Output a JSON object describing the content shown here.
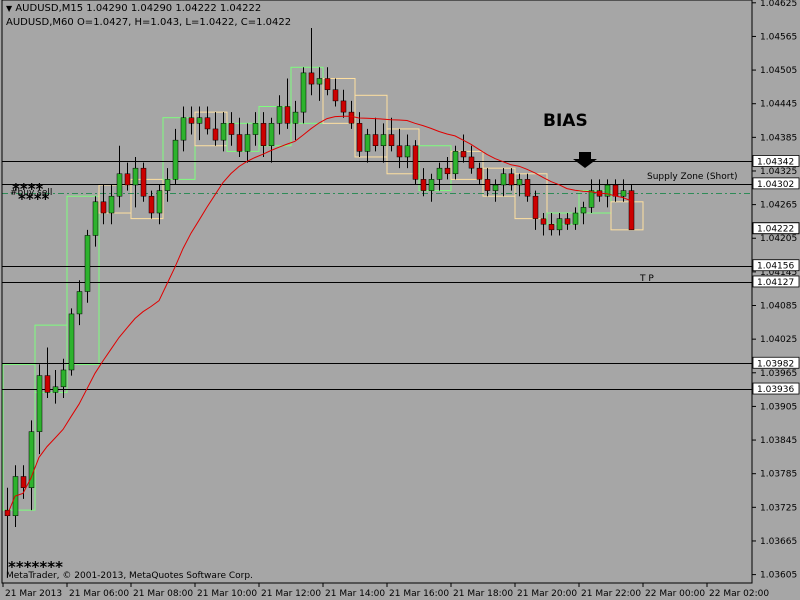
{
  "header": {
    "line1": "AUDUSD,M15  1.04290 1.04290 1.04222 1.04222",
    "line2": "AUDUSD,M60   O=1.0427,   H=1.043,   L=1.0422,   C=1.0422"
  },
  "colors": {
    "background": "#a6a6a6",
    "bull": "#2db32d",
    "bear": "#cc0000",
    "ma": "#e00000",
    "h1_bull_box": "#7dff7d",
    "h1_bear_box": "#ffe0a0",
    "hline": "#000000",
    "dashline": "#2e8b57"
  },
  "annotations": {
    "bias": "BIAS",
    "supply_zone": "Supply Zone (Short)",
    "tp": "T  P",
    "stars_top": "****",
    "stars_bottom": "*******",
    "label_buy_sell": "#buy sell",
    "copyright": "MetaTrader, © 2001-2013, MetaQuotes Software Corp."
  },
  "chart_data": {
    "type": "candlestick",
    "symbol": "AUDUSD",
    "timeframe": "M15",
    "ylim": [
      1.0359,
      1.0463
    ],
    "price_ticks": [
      "1.04625",
      "1.04565",
      "1.04505",
      "1.04445",
      "1.04385",
      "1.04325",
      "1.04265",
      "1.04205",
      "1.04145",
      "1.04085",
      "1.04025",
      "1.03965",
      "1.03905",
      "1.03845",
      "1.03785",
      "1.03725",
      "1.03665",
      "1.03605"
    ],
    "time_ticks": [
      {
        "label": "21 Mar 2013",
        "bar": 0
      },
      {
        "label": "21 Mar 06:00",
        "bar": 8
      },
      {
        "label": "21 Mar 08:00",
        "bar": 16
      },
      {
        "label": "21 Mar 10:00",
        "bar": 24
      },
      {
        "label": "21 Mar 12:00",
        "bar": 32
      },
      {
        "label": "21 Mar 14:00",
        "bar": 40
      },
      {
        "label": "21 Mar 16:00",
        "bar": 48
      },
      {
        "label": "21 Mar 18:00",
        "bar": 56
      },
      {
        "label": "21 Mar 20:00",
        "bar": 64
      },
      {
        "label": "21 Mar 22:00",
        "bar": 72
      },
      {
        "label": "22 Mar 00:00",
        "bar": 80
      },
      {
        "label": "22 Mar 02:00",
        "bar": 88
      }
    ],
    "levels": [
      {
        "price": 1.04342,
        "label": "1.04342",
        "style": "solid"
      },
      {
        "price": 1.04302,
        "label": "1.04302",
        "style": "solid"
      },
      {
        "price": 1.04285,
        "label": "",
        "style": "dash"
      },
      {
        "price": 1.04222,
        "label": "1.04222",
        "style": "current"
      },
      {
        "price": 1.04156,
        "label": "1.04156",
        "style": "solid"
      },
      {
        "price": 1.04127,
        "label": "1.04127",
        "style": "solid"
      },
      {
        "price": 1.03982,
        "label": "1.03982",
        "style": "solid"
      },
      {
        "price": 1.03936,
        "label": "1.03936",
        "style": "solid"
      }
    ],
    "candles": [
      [
        1.0372,
        1.0376,
        1.036,
        1.0371
      ],
      [
        1.0371,
        1.038,
        1.0369,
        1.0378
      ],
      [
        1.0378,
        1.038,
        1.0374,
        1.0376
      ],
      [
        1.0376,
        1.0388,
        1.0372,
        1.0386
      ],
      [
        1.0386,
        1.0398,
        1.0382,
        1.0396
      ],
      [
        1.0396,
        1.0401,
        1.0392,
        1.0393
      ],
      [
        1.0393,
        1.0397,
        1.0391,
        1.0394
      ],
      [
        1.0394,
        1.0399,
        1.0392,
        1.0397
      ],
      [
        1.0397,
        1.0408,
        1.0396,
        1.0407
      ],
      [
        1.0407,
        1.0413,
        1.0405,
        1.0411
      ],
      [
        1.0411,
        1.0422,
        1.0409,
        1.0421
      ],
      [
        1.0421,
        1.0428,
        1.0419,
        1.0427
      ],
      [
        1.0427,
        1.043,
        1.0423,
        1.0425
      ],
      [
        1.0425,
        1.043,
        1.0423,
        1.0428
      ],
      [
        1.0428,
        1.0437,
        1.0426,
        1.0432
      ],
      [
        1.0432,
        1.0434,
        1.0429,
        1.043
      ],
      [
        1.043,
        1.0435,
        1.0426,
        1.0433
      ],
      [
        1.0433,
        1.0434,
        1.0427,
        1.0428
      ],
      [
        1.0428,
        1.0429,
        1.0424,
        1.0425
      ],
      [
        1.0425,
        1.043,
        1.0423,
        1.0429
      ],
      [
        1.0429,
        1.0433,
        1.0427,
        1.0431
      ],
      [
        1.0431,
        1.044,
        1.043,
        1.0438
      ],
      [
        1.0438,
        1.0444,
        1.0436,
        1.0442
      ],
      [
        1.0442,
        1.0444,
        1.0439,
        1.0441
      ],
      [
        1.0441,
        1.0444,
        1.0438,
        1.0442
      ],
      [
        1.0442,
        1.0444,
        1.0439,
        1.044
      ],
      [
        1.044,
        1.0443,
        1.0437,
        1.0438
      ],
      [
        1.0438,
        1.0443,
        1.0436,
        1.0441
      ],
      [
        1.0441,
        1.0443,
        1.0437,
        1.0439
      ],
      [
        1.0439,
        1.0442,
        1.0435,
        1.0436
      ],
      [
        1.0436,
        1.0441,
        1.0434,
        1.0439
      ],
      [
        1.0439,
        1.0443,
        1.0437,
        1.0441
      ],
      [
        1.0441,
        1.0443,
        1.0435,
        1.0437
      ],
      [
        1.0437,
        1.0442,
        1.0434,
        1.0441
      ],
      [
        1.0441,
        1.0446,
        1.0439,
        1.0444
      ],
      [
        1.0444,
        1.0449,
        1.044,
        1.0441
      ],
      [
        1.0441,
        1.0445,
        1.0438,
        1.0443
      ],
      [
        1.0443,
        1.0451,
        1.0441,
        1.045
      ],
      [
        1.045,
        1.0458,
        1.0446,
        1.0448
      ],
      [
        1.0448,
        1.0451,
        1.0445,
        1.0449
      ],
      [
        1.0449,
        1.0451,
        1.0446,
        1.0447
      ],
      [
        1.0447,
        1.0449,
        1.0444,
        1.0445
      ],
      [
        1.0445,
        1.0447,
        1.0442,
        1.0443
      ],
      [
        1.0443,
        1.0445,
        1.044,
        1.0441
      ],
      [
        1.0441,
        1.0443,
        1.0435,
        1.0436
      ],
      [
        1.0436,
        1.044,
        1.0434,
        1.0439
      ],
      [
        1.0439,
        1.0442,
        1.0436,
        1.0437
      ],
      [
        1.0437,
        1.0441,
        1.0434,
        1.0439
      ],
      [
        1.0439,
        1.0442,
        1.0436,
        1.0437
      ],
      [
        1.0437,
        1.044,
        1.0433,
        1.0435
      ],
      [
        1.0435,
        1.0439,
        1.0433,
        1.0437
      ],
      [
        1.0437,
        1.0438,
        1.043,
        1.0431
      ],
      [
        1.0431,
        1.0433,
        1.0428,
        1.0429
      ],
      [
        1.0429,
        1.0432,
        1.0427,
        1.0431
      ],
      [
        1.0431,
        1.0434,
        1.0429,
        1.0433
      ],
      [
        1.0433,
        1.0435,
        1.0431,
        1.0432
      ],
      [
        1.0432,
        1.0437,
        1.0431,
        1.0436
      ],
      [
        1.0436,
        1.0439,
        1.0434,
        1.0435
      ],
      [
        1.0435,
        1.0437,
        1.0432,
        1.0433
      ],
      [
        1.0433,
        1.0434,
        1.043,
        1.0431
      ],
      [
        1.0431,
        1.0433,
        1.0428,
        1.0429
      ],
      [
        1.0429,
        1.0431,
        1.0427,
        1.043
      ],
      [
        1.043,
        1.0433,
        1.0428,
        1.0432
      ],
      [
        1.0432,
        1.0433,
        1.0429,
        1.043
      ],
      [
        1.043,
        1.0432,
        1.0428,
        1.0431
      ],
      [
        1.0431,
        1.0432,
        1.0427,
        1.0428
      ],
      [
        1.0428,
        1.0429,
        1.0422,
        1.0424
      ],
      [
        1.0424,
        1.0425,
        1.0421,
        1.0423
      ],
      [
        1.0423,
        1.0425,
        1.0421,
        1.0422
      ],
      [
        1.0422,
        1.0425,
        1.0421,
        1.0424
      ],
      [
        1.0424,
        1.0425,
        1.0422,
        1.0423
      ],
      [
        1.0423,
        1.0426,
        1.0422,
        1.0425
      ],
      [
        1.0425,
        1.0427,
        1.0423,
        1.0426
      ],
      [
        1.0426,
        1.0431,
        1.0425,
        1.0429
      ],
      [
        1.0429,
        1.0431,
        1.0427,
        1.0428
      ],
      [
        1.0428,
        1.0431,
        1.0426,
        1.043
      ],
      [
        1.043,
        1.0431,
        1.0427,
        1.0428
      ],
      [
        1.0428,
        1.0431,
        1.0427,
        1.0429
      ],
      [
        1.0429,
        1.043,
        1.0422,
        1.0422
      ]
    ],
    "h1_boxes": [
      [
        0,
        4,
        1.0372,
        1.0398,
        1
      ],
      [
        4,
        8,
        1.0393,
        1.0405,
        1
      ],
      [
        8,
        12,
        1.0398,
        1.0428,
        1
      ],
      [
        12,
        16,
        1.0425,
        1.043,
        0
      ],
      [
        16,
        20,
        1.0424,
        1.0431,
        0
      ],
      [
        20,
        24,
        1.0431,
        1.0442,
        1
      ],
      [
        24,
        28,
        1.0437,
        1.0443,
        0
      ],
      [
        28,
        32,
        1.0436,
        1.0441,
        1
      ],
      [
        32,
        36,
        1.0437,
        1.0444,
        1
      ],
      [
        36,
        40,
        1.0441,
        1.0451,
        1
      ],
      [
        40,
        44,
        1.0441,
        1.0449,
        0
      ],
      [
        44,
        48,
        1.0435,
        1.0446,
        0
      ],
      [
        48,
        52,
        1.0432,
        1.044,
        0
      ],
      [
        52,
        56,
        1.0429,
        1.0437,
        1
      ],
      [
        56,
        60,
        1.0431,
        1.0436,
        0
      ],
      [
        60,
        64,
        1.0428,
        1.0433,
        0
      ],
      [
        64,
        68,
        1.0424,
        1.0432,
        0
      ],
      [
        68,
        72,
        1.0423,
        1.0425,
        1
      ],
      [
        72,
        76,
        1.0425,
        1.0429,
        1
      ],
      [
        76,
        80,
        1.0422,
        1.0427,
        0
      ]
    ],
    "ma_period": 20
  }
}
